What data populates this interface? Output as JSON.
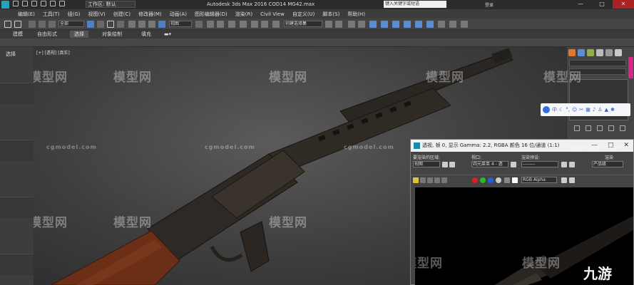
{
  "titlebar": {
    "workspace_label": "工作区: 默认",
    "title": "Autodesk 3ds Max 2016     COD14 MG42.max",
    "search_placeholder": "键入关键字或短语",
    "login": "登录",
    "minimize": "—",
    "maximize": "□",
    "close": "✕"
  },
  "menu": [
    "编辑(E)",
    "工具(T)",
    "组(G)",
    "视图(V)",
    "创建(C)",
    "修改器(M)",
    "动画(A)",
    "图形编辑器(D)",
    "渲染(R)",
    "Civil View",
    "自定义(U)",
    "脚本(S)",
    "帮助(H)"
  ],
  "toolbar": {
    "filter_value": "全部",
    "view_value": "视图",
    "selection_set": "创建选择集"
  },
  "ribbon": {
    "tabs": [
      "建模",
      "自由形式",
      "选择",
      "对象绘制",
      "填充"
    ],
    "active_tab": "选择"
  },
  "left_panel": {
    "label": "选择"
  },
  "viewport": {
    "label": "[+] [透视] [真实]"
  },
  "ime": {
    "lang": "中"
  },
  "render_window": {
    "title": "透视, 帧 0, 显示 Gamma: 2.2, RGBA 颜色 16 位/通道 (1:1)",
    "area_label": "要渲染的区域:",
    "area_value": "视图",
    "viewport_label": "视口:",
    "viewport_value": "四元菜单 4 - 透",
    "preset_label": "渲染预设:",
    "preset_value": "--------",
    "render_label": "渲染",
    "render_value": "产品级",
    "channel_value": "RGB Alpha"
  },
  "watermarks": {
    "brand": "模型网",
    "site": "cgmodel.com",
    "corner_logo": "九游"
  },
  "colors": {
    "title_bar": "#2b2b2b",
    "menu_bar": "#3c3c3c",
    "panel": "#444444",
    "accent_scroll": "#d8268a",
    "stock_wood": "#6b2f17",
    "gun_metal": "#2b2723",
    "render_bg": "#000000"
  },
  "icons": [
    "app-logo-icon",
    "undo-icon",
    "redo-icon",
    "select-icon",
    "move-icon",
    "rotate-icon",
    "scale-icon",
    "snap-icon",
    "render-icon",
    "teapot-icon"
  ]
}
